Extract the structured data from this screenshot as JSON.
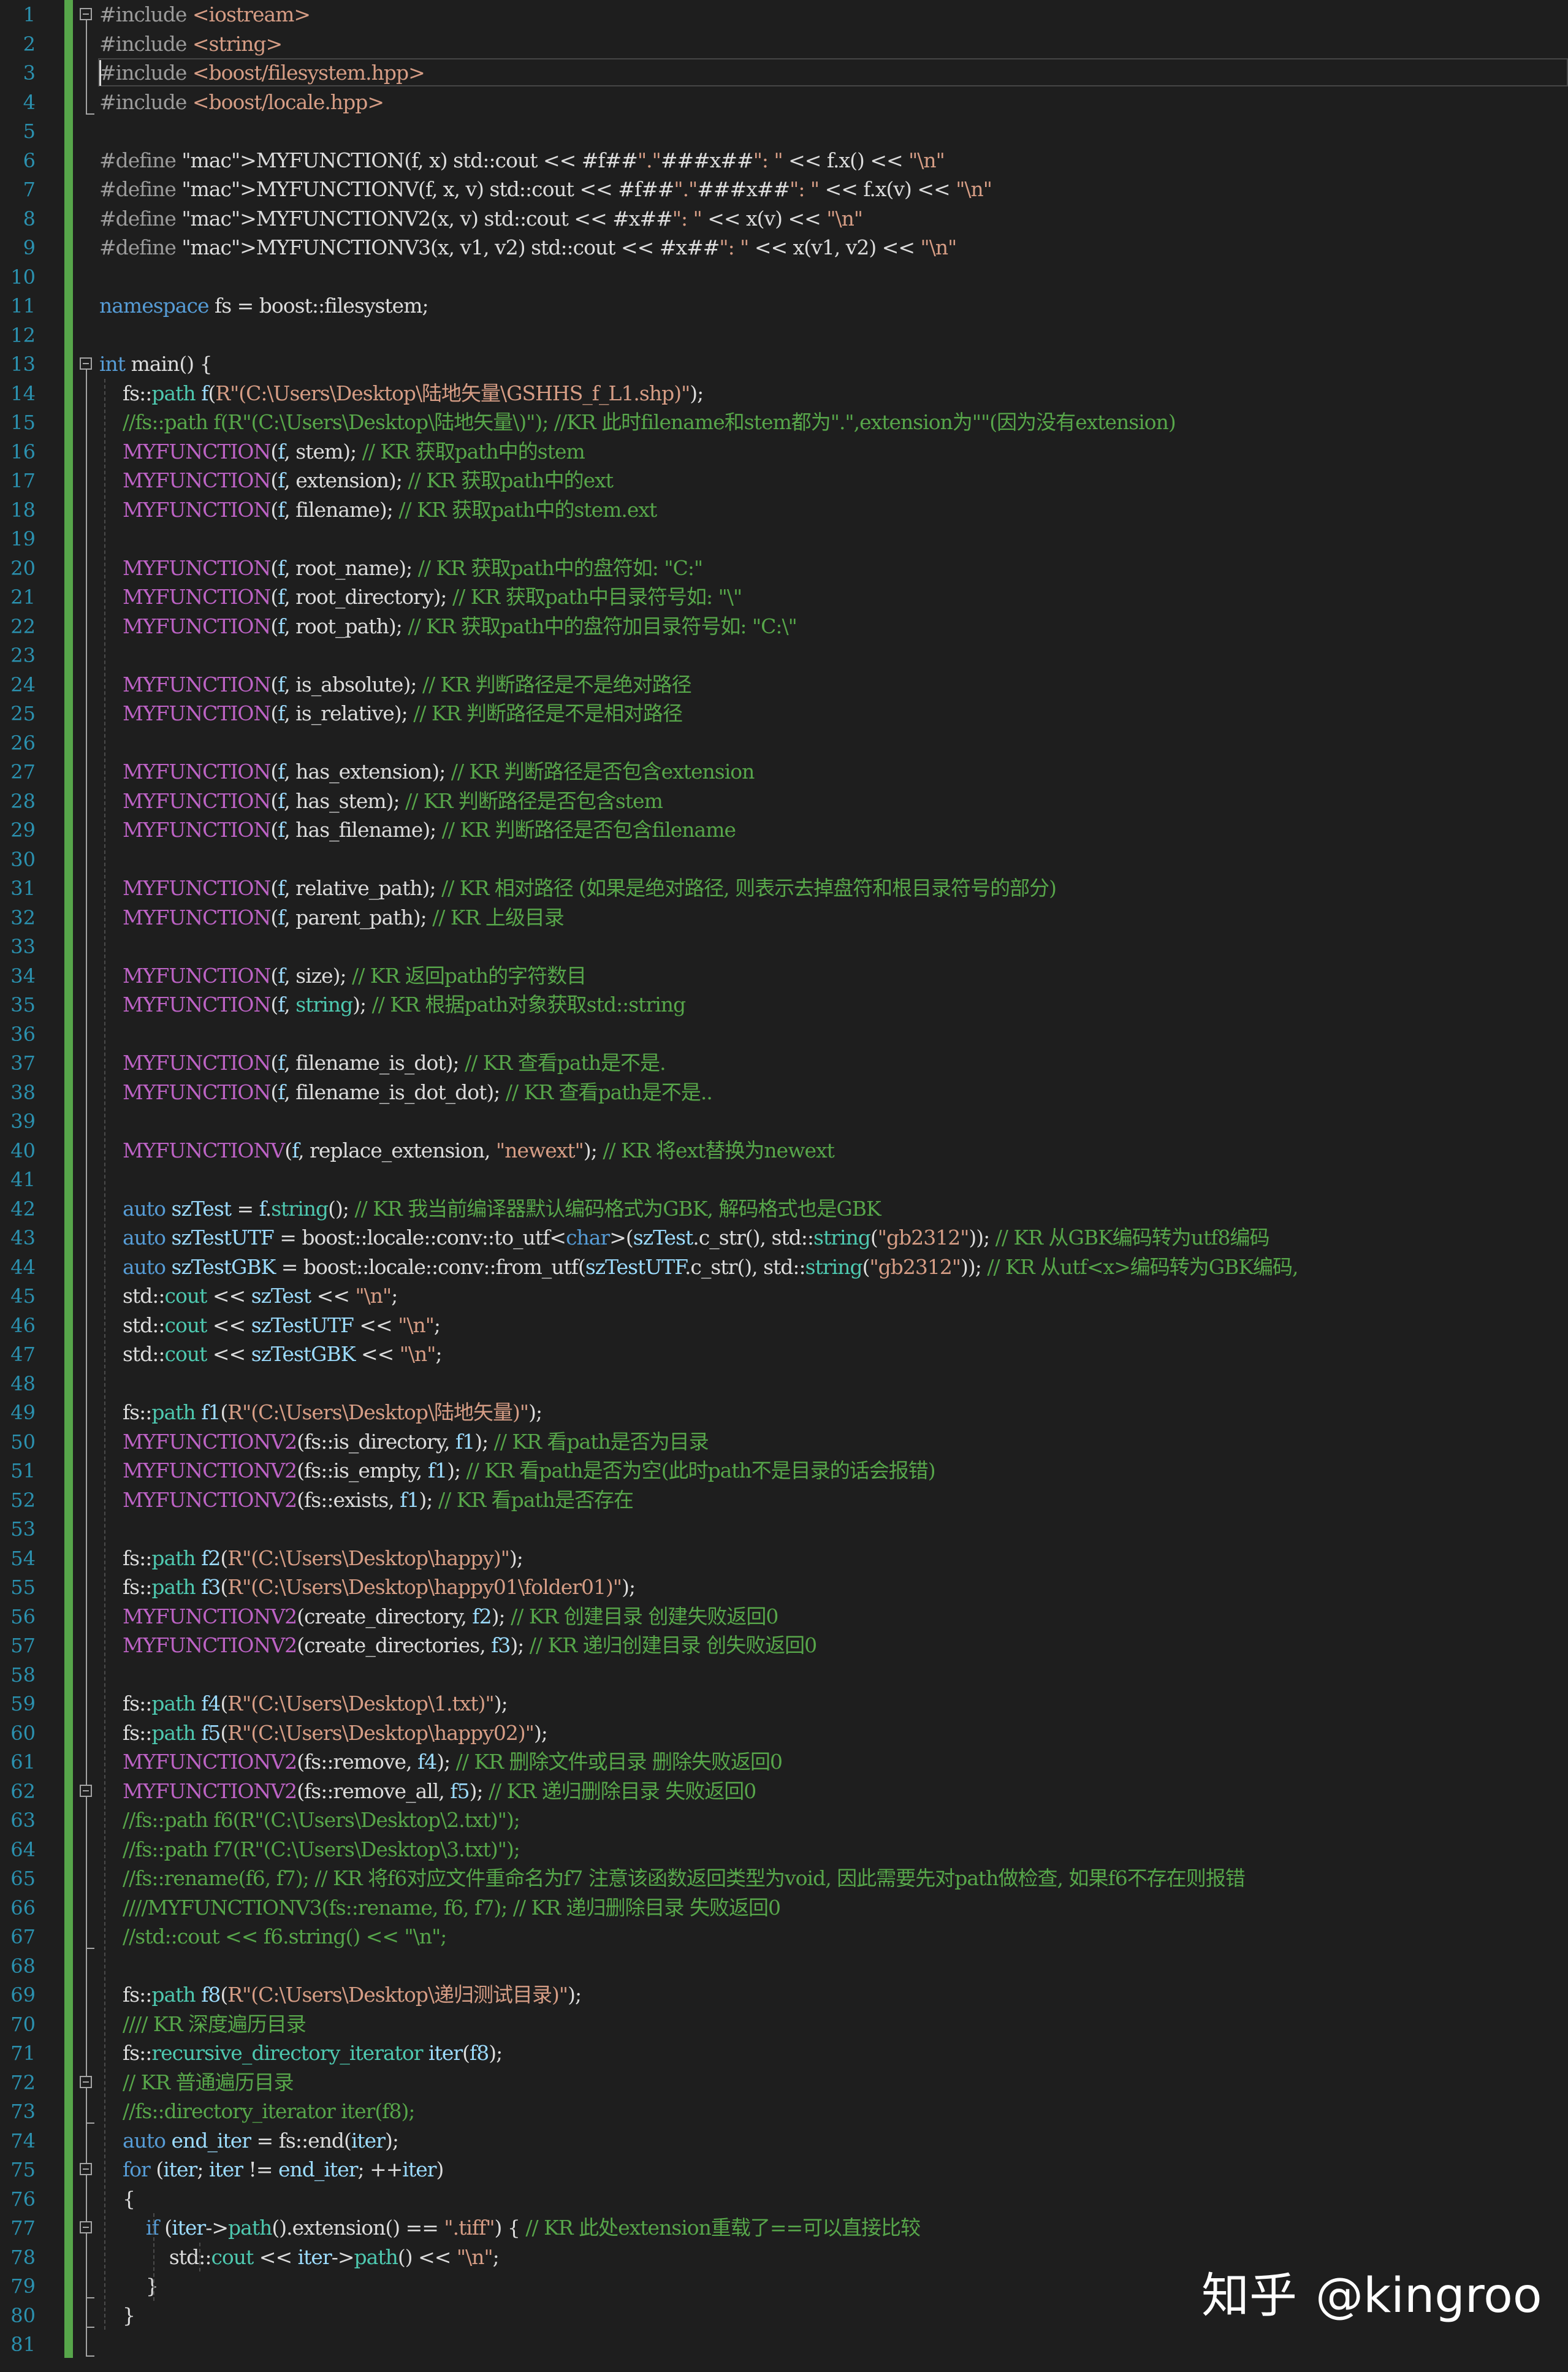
{
  "editor": {
    "language": "C++",
    "theme_colors": {
      "background": "#1e1e1e",
      "line_number": "#2b91af",
      "keyword": "#569cd6",
      "string": "#d69d85",
      "comment": "#57a64a",
      "macro": "#bd63c5",
      "change_bar": "#57a64a"
    },
    "lines": [
      "#include <iostream>",
      "#include <string>",
      "#include <boost/filesystem.hpp>",
      "#include <boost/locale.hpp>",
      "",
      "#define MYFUNCTION(f, x) std::cout << #f##\".\"###x##\": \" << f.x() << \"\\n\"",
      "#define MYFUNCTIONV(f, x, v) std::cout << #f##\".\"###x##\": \" << f.x(v) << \"\\n\"",
      "#define MYFUNCTIONV2(x, v) std::cout << #x##\": \" << x(v) << \"\\n\"",
      "#define MYFUNCTIONV3(x, v1, v2) std::cout << #x##\": \" << x(v1, v2) << \"\\n\"",
      "",
      "namespace fs = boost::filesystem;",
      "",
      "int main() {",
      "    fs::path f(R\"(C:\\Users\\Desktop\\陆地矢量\\GSHHS_f_L1.shp)\");",
      "    //fs::path f(R\"(C:\\Users\\Desktop\\陆地矢量\\)\"); //KR 此时filename和stem都为\".\",extension为\"\"(因为没有extension)",
      "    MYFUNCTION(f, stem); // KR 获取path中的stem",
      "    MYFUNCTION(f, extension); // KR 获取path中的ext",
      "    MYFUNCTION(f, filename); // KR 获取path中的stem.ext",
      "",
      "    MYFUNCTION(f, root_name); // KR 获取path中的盘符如: \"C:\"",
      "    MYFUNCTION(f, root_directory); // KR 获取path中目录符号如: \"\\\"",
      "    MYFUNCTION(f, root_path); // KR 获取path中的盘符加目录符号如: \"C:\\\"",
      "",
      "    MYFUNCTION(f, is_absolute); // KR 判断路径是不是绝对路径",
      "    MYFUNCTION(f, is_relative); // KR 判断路径是不是相对路径",
      "",
      "    MYFUNCTION(f, has_extension); // KR 判断路径是否包含extension",
      "    MYFUNCTION(f, has_stem); // KR 判断路径是否包含stem",
      "    MYFUNCTION(f, has_filename); // KR 判断路径是否包含filename",
      "",
      "    MYFUNCTION(f, relative_path); // KR 相对路径 (如果是绝对路径, 则表示去掉盘符和根目录符号的部分)",
      "    MYFUNCTION(f, parent_path); // KR 上级目录",
      "",
      "    MYFUNCTION(f, size); // KR 返回path的字符数目",
      "    MYFUNCTION(f, string); // KR 根据path对象获取std::string",
      "",
      "    MYFUNCTION(f, filename_is_dot); // KR 查看path是不是.",
      "    MYFUNCTION(f, filename_is_dot_dot); // KR 查看path是不是..",
      "",
      "    MYFUNCTIONV(f, replace_extension, \"newext\"); // KR 将ext替换为newext",
      "",
      "    auto szTest = f.string(); // KR 我当前编译器默认编码格式为GBK, 解码格式也是GBK",
      "    auto szTestUTF = boost::locale::conv::to_utf<char>(szTest.c_str(), std::string(\"gb2312\")); // KR 从GBK编码转为utf8编码",
      "    auto szTestGBK = boost::locale::conv::from_utf(szTestUTF.c_str(), std::string(\"gb2312\")); // KR 从utf<x>编码转为GBK编码,",
      "    std::cout << szTest << \"\\n\";",
      "    std::cout << szTestUTF << \"\\n\";",
      "    std::cout << szTestGBK << \"\\n\";",
      "",
      "    fs::path f1(R\"(C:\\Users\\Desktop\\陆地矢量)\");",
      "    MYFUNCTIONV2(fs::is_directory, f1); // KR 看path是否为目录",
      "    MYFUNCTIONV2(fs::is_empty, f1); // KR 看path是否为空(此时path不是目录的话会报错)",
      "    MYFUNCTIONV2(fs::exists, f1); // KR 看path是否存在",
      "",
      "    fs::path f2(R\"(C:\\Users\\Desktop\\happy)\");",
      "    fs::path f3(R\"(C:\\Users\\Desktop\\happy01\\folder01)\");",
      "    MYFUNCTIONV2(create_directory, f2); // KR 创建目录 创建失败返回0",
      "    MYFUNCTIONV2(create_directories, f3); // KR 递归创建目录 创失败返回0",
      "",
      "    fs::path f4(R\"(C:\\Users\\Desktop\\1.txt)\");",
      "    fs::path f5(R\"(C:\\Users\\Desktop\\happy02)\");",
      "    MYFUNCTIONV2(fs::remove, f4); // KR 删除文件或目录 删除失败返回0",
      "    MYFUNCTIONV2(fs::remove_all, f5); // KR 递归删除目录 失败返回0",
      "    //fs::path f6(R\"(C:\\Users\\Desktop\\2.txt)\");",
      "    //fs::path f7(R\"(C:\\Users\\Desktop\\3.txt)\");",
      "    //fs::rename(f6, f7); // KR 将f6对应文件重命名为f7 注意该函数返回类型为void, 因此需要先对path做检查, 如果f6不存在则报错",
      "    ////MYFUNCTIONV3(fs::rename, f6, f7); // KR 递归删除目录 失败返回0",
      "    //std::cout << f6.string() << \"\\n\";",
      "",
      "    fs::path f8(R\"(C:\\Users\\Desktop\\递归测试目录)\");",
      "    //// KR 深度遍历目录",
      "    fs::recursive_directory_iterator iter(f8);",
      "    // KR 普通遍历目录",
      "    //fs::directory_iterator iter(f8);",
      "    auto end_iter = fs::end(iter);",
      "    for (iter; iter != end_iter; ++iter)",
      "    {",
      "        if (iter->path().extension() == \".tiff\") { // KR 此处extension重载了==可以直接比较",
      "            std::cout << iter->path() << \"\\n\";",
      "        }",
      "    }",
      ""
    ]
  },
  "watermark": {
    "brand": "知乎",
    "handle": "@kingroo"
  }
}
